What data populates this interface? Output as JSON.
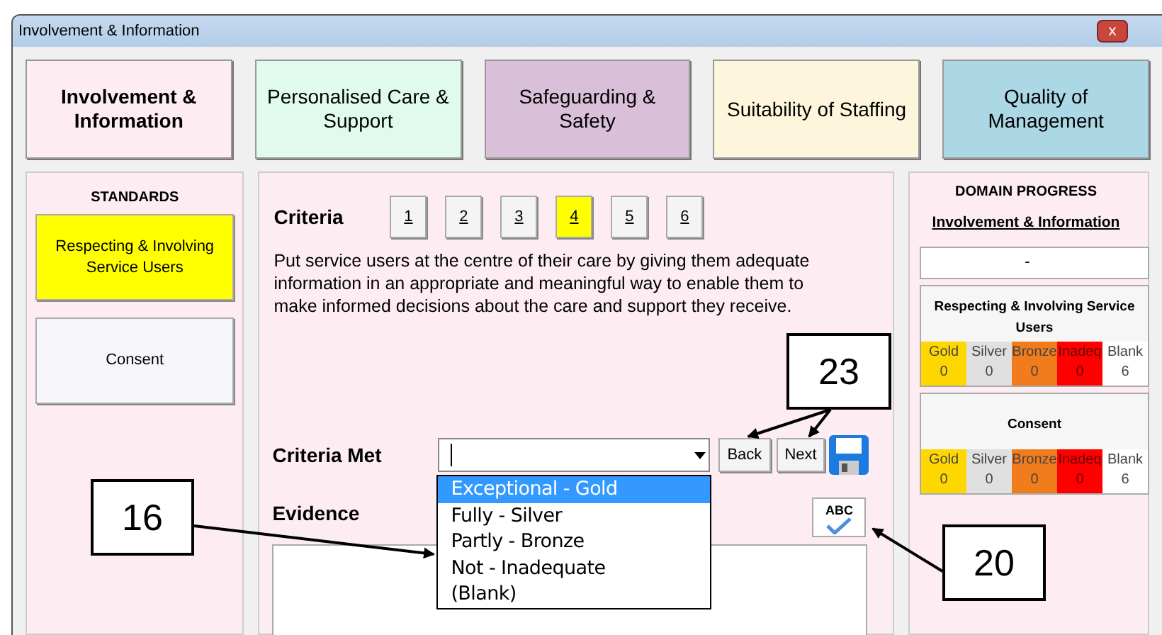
{
  "window": {
    "title": "Involvement & Information",
    "close": "x"
  },
  "domains": [
    {
      "label": "Involvement & Information",
      "selected": true,
      "color": "#fdedf2"
    },
    {
      "label": "Personalised Care & Support",
      "selected": false,
      "color": "#e0fbee"
    },
    {
      "label": "Safeguarding & Safety",
      "selected": false,
      "color": "#d9bfd8"
    },
    {
      "label": "Suitability of Staffing",
      "selected": false,
      "color": "#fdf6dc"
    },
    {
      "label": "Quality of Management",
      "selected": false,
      "color": "#abd8e4"
    }
  ],
  "standards": {
    "title": "STANDARDS",
    "items": [
      {
        "label": "Respecting & Involving Service Users",
        "selected": true
      },
      {
        "label": "Consent",
        "selected": false
      }
    ]
  },
  "criteria": {
    "label": "Criteria",
    "numbers": [
      {
        "label": "1",
        "selected": false
      },
      {
        "label": "2",
        "selected": false
      },
      {
        "label": "3",
        "selected": false
      },
      {
        "label": "4",
        "selected": true
      },
      {
        "label": "5",
        "selected": false
      },
      {
        "label": "6",
        "selected": false
      }
    ],
    "description": "Put service users at the centre of their care by giving them adequate information in an appropriate and meaningful way to enable them to make informed decisions about the care and support they receive."
  },
  "criteria_met": {
    "label": "Criteria Met",
    "expanded": true,
    "options": [
      {
        "label": "Exceptional - Gold",
        "selected": true
      },
      {
        "label": "Fully - Silver",
        "selected": false
      },
      {
        "label": "Partly - Bronze",
        "selected": false
      },
      {
        "label": "Not - Inadequate",
        "selected": false
      },
      {
        "label": "(Blank)",
        "selected": false
      }
    ]
  },
  "buttons": [
    "Back",
    "Next"
  ],
  "evidence": {
    "label": "Evidence",
    "spellcheck": "ABC"
  },
  "domain_progress": {
    "title": "DOMAIN PROGRESS",
    "domain": "Involvement & Information",
    "value": "-",
    "standards": [
      {
        "name": "Respecting & Involving Service Users",
        "grades": [
          {
            "label": "Gold",
            "count": "0",
            "color": "#ffd700"
          },
          {
            "label": "Silver",
            "count": "0",
            "color": "#e0e0e0"
          },
          {
            "label": "Bronze",
            "count": "0",
            "color": "#f07c1c"
          },
          {
            "label": "Inadeq",
            "count": "0",
            "color": "#ff0000"
          },
          {
            "label": "Blank",
            "count": "6",
            "color": "#ffffff"
          }
        ]
      },
      {
        "name": "Consent",
        "grades": [
          {
            "label": "Gold",
            "count": "0",
            "color": "#ffd700"
          },
          {
            "label": "Silver",
            "count": "0",
            "color": "#e0e0e0"
          },
          {
            "label": "Bronze",
            "count": "0",
            "color": "#f07c1c"
          },
          {
            "label": "Inadeq",
            "count": "0",
            "color": "#ff0000"
          },
          {
            "label": "Blank",
            "count": "6",
            "color": "#ffffff"
          }
        ]
      }
    ]
  },
  "callouts": [
    "16",
    "23",
    "20"
  ]
}
